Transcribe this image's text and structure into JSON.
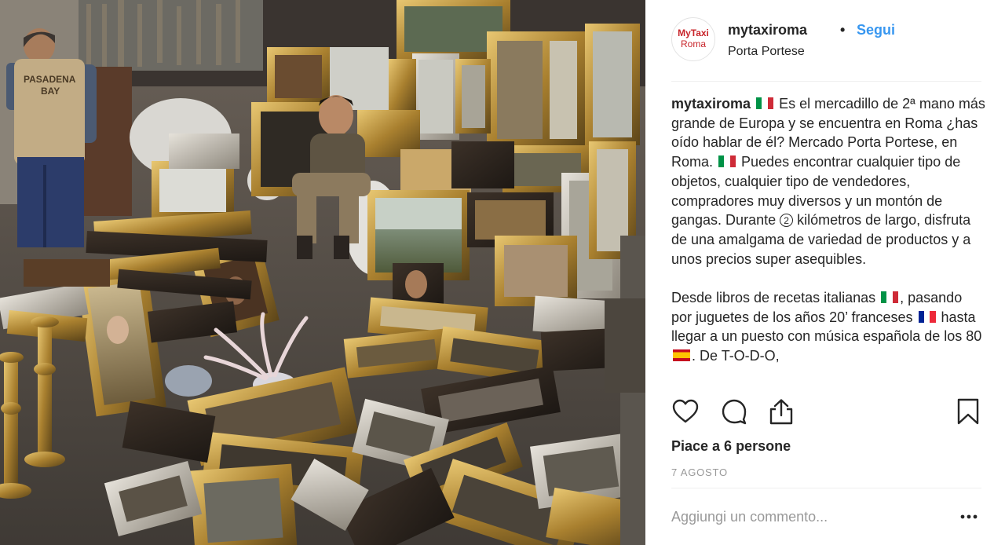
{
  "post": {
    "avatar": {
      "line1": "MyTaxi",
      "line2": "Roma"
    },
    "username": "mytaxiroma",
    "separator": "•",
    "follow_label": "Segui",
    "location": "Porta Portese",
    "caption": {
      "author": "mytaxiroma",
      "p1_a": " Es el mercadillo de 2ª mano más grande de Europa y se encuentra en Roma ¿has oído hablar de él? Mercado Porta Portese, en Roma. ",
      "p1_b": " Puedes encontrar cualquier tipo de objetos, cualquier tipo de vendedores, compradores muy diversos y un montón de gangas. Durante ",
      "p1_num": "2",
      "p1_c": " kilómetros de largo, disfruta de una amalgama de variedad de productos y a unos precios super asequibles.",
      "p2_a": "Desde libros de recetas italianas ",
      "p2_b": ", pasando por juguetes de los años 20’ franceses ",
      "p2_c": " hasta llegar a un puesto con música española de los 80 ",
      "p2_d": ". De T-O-D-O,"
    },
    "actions": {
      "like_icon": "heart-icon",
      "comment_icon": "comment-bubble-icon",
      "share_icon": "share-upload-icon",
      "save_icon": "bookmark-icon"
    },
    "likes_text": "Piace a 6 persone",
    "date": "7 AGOSTO",
    "comment_placeholder": "Aggiungi un commento...",
    "more_icon": "ellipsis-icon"
  },
  "photo": {
    "vest_text_1": "PASADENA",
    "vest_text_2": "BAY"
  },
  "colors": {
    "link_blue": "#3897f0",
    "brand_red": "#c8242a",
    "muted_gray": "#999999",
    "text": "#262626"
  }
}
